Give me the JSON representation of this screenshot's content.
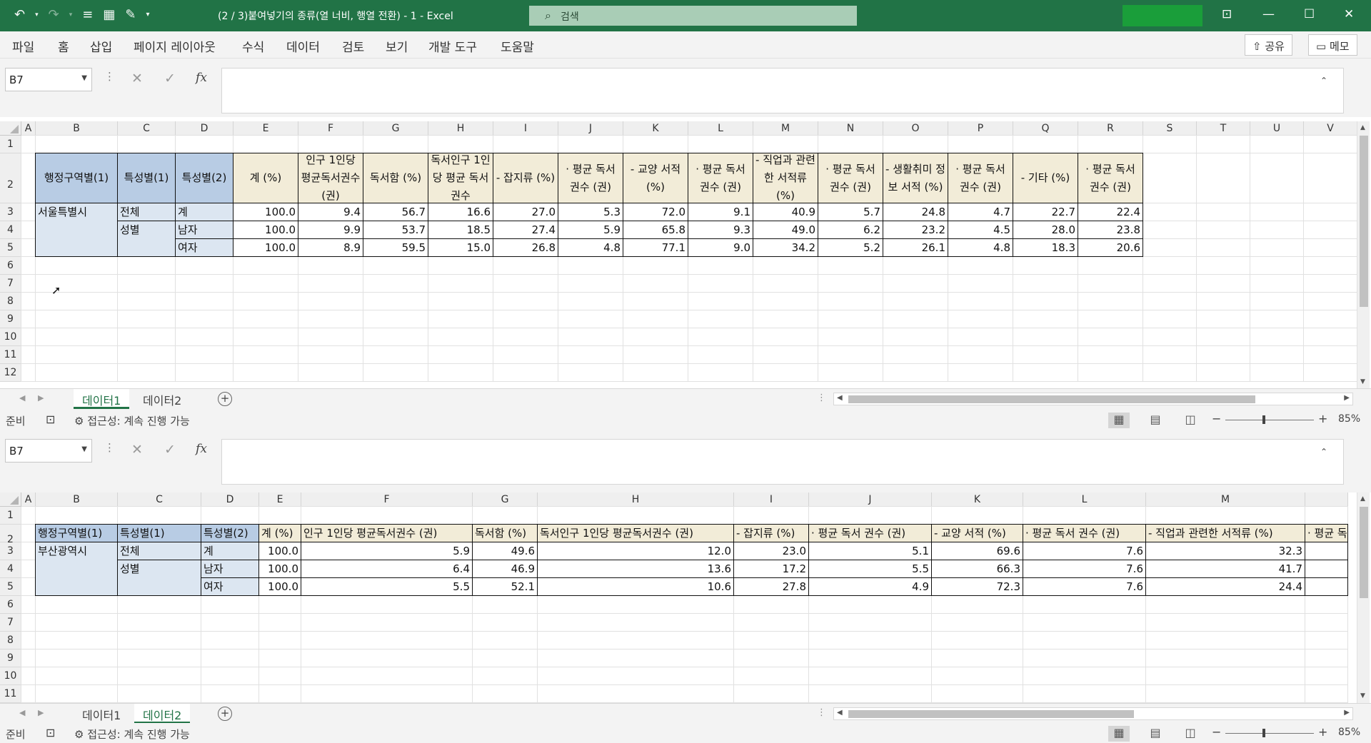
{
  "titlebar": {
    "undo_icon": "undo-icon",
    "title": "(2 / 3)붙여넣기의 종류(열 너비, 행열 전환)  -  1  -  Excel",
    "search_placeholder": "검색",
    "minimize": "—",
    "restore": "☐",
    "close": "✕",
    "ribbon_display": "⊡"
  },
  "menu": {
    "items": [
      "파일",
      "홈",
      "삽입",
      "페이지 레이아웃",
      "수식",
      "데이터",
      "검토",
      "보기",
      "개발 도구",
      "도움말"
    ],
    "share": "⇧ 공유",
    "memo": "▭ 메모"
  },
  "window1": {
    "namebox": "B7",
    "formula_value": "",
    "columns": [
      {
        "label": "A",
        "w": 20
      },
      {
        "label": "B",
        "w": 115
      },
      {
        "label": "C",
        "w": 81
      },
      {
        "label": "D",
        "w": 81
      },
      {
        "label": "E",
        "w": 91
      },
      {
        "label": "F",
        "w": 91
      },
      {
        "label": "G",
        "w": 91
      },
      {
        "label": "H",
        "w": 91
      },
      {
        "label": "I",
        "w": 91
      },
      {
        "label": "J",
        "w": 91
      },
      {
        "label": "K",
        "w": 91
      },
      {
        "label": "L",
        "w": 91
      },
      {
        "label": "M",
        "w": 91
      },
      {
        "label": "N",
        "w": 91
      },
      {
        "label": "O",
        "w": 91
      },
      {
        "label": "P",
        "w": 91
      },
      {
        "label": "Q",
        "w": 91
      },
      {
        "label": "R",
        "w": 91
      },
      {
        "label": "S",
        "w": 75
      },
      {
        "label": "T",
        "w": 75
      },
      {
        "label": "U",
        "w": 75
      },
      {
        "label": "V",
        "w": 75
      }
    ],
    "rows": [
      "1",
      "2",
      "3",
      "4",
      "5",
      "6",
      "7",
      "8",
      "9",
      "10",
      "11",
      "12"
    ],
    "headers": [
      "행정구역별(1)",
      "특성별(1)",
      "특성별(2)",
      "계 (%)",
      "인구 1인당 평균독서권수 (권)",
      "독서함 (%)",
      "독서인구 1인당 평균 독서권수",
      "- 잡지류 (%)",
      "· 평균 독서 권수 (권)",
      "- 교양 서적 (%)",
      "· 평균 독서 권수 (권)",
      "- 직업과 관련한 서적류 (%)",
      "· 평균 독서 권수 (권)",
      "- 생활취미 정보 서적 (%)",
      "· 평균 독서 권수 (권)",
      "- 기타 (%)",
      "· 평균 독서 권수 (권)"
    ],
    "region": "서울특별시",
    "cat1": [
      "전체",
      "성별"
    ],
    "cat2": [
      "계",
      "남자",
      "여자"
    ],
    "values": [
      [
        "100.0",
        "9.4",
        "56.7",
        "16.6",
        "27.0",
        "5.3",
        "72.0",
        "9.1",
        "40.9",
        "5.7",
        "24.8",
        "4.7",
        "22.7",
        "22.4"
      ],
      [
        "100.0",
        "9.9",
        "53.7",
        "18.5",
        "27.4",
        "5.9",
        "65.8",
        "9.3",
        "49.0",
        "6.2",
        "23.2",
        "4.5",
        "28.0",
        "23.8"
      ],
      [
        "100.0",
        "8.9",
        "59.5",
        "15.0",
        "26.8",
        "4.8",
        "77.1",
        "9.0",
        "34.2",
        "5.2",
        "26.1",
        "4.8",
        "18.3",
        "20.6"
      ]
    ],
    "tabs": [
      "데이터1",
      "데이터2"
    ],
    "active_tab": 0
  },
  "window2": {
    "namebox": "B7",
    "formula_value": "",
    "columns": [
      {
        "label": "A",
        "w": 20
      },
      {
        "label": "B",
        "w": 115
      },
      {
        "label": "C",
        "w": 117
      },
      {
        "label": "D",
        "w": 81
      },
      {
        "label": "E",
        "w": 59
      },
      {
        "label": "F",
        "w": 240
      },
      {
        "label": "G",
        "w": 91
      },
      {
        "label": "H",
        "w": 275
      },
      {
        "label": "I",
        "w": 105
      },
      {
        "label": "J",
        "w": 172
      },
      {
        "label": "K",
        "w": 128
      },
      {
        "label": "L",
        "w": 172
      },
      {
        "label": "M",
        "w": 223
      },
      {
        "label": "",
        "w": 60
      }
    ],
    "rows": [
      "1",
      "2",
      "3",
      "4",
      "5",
      "6",
      "7",
      "8",
      "9",
      "10",
      "11"
    ],
    "headers": [
      "행정구역별(1)",
      "특성별(1)",
      "특성별(2)",
      "계 (%)",
      "인구 1인당 평균독서권수 (권)",
      "독서함 (%)",
      "독서인구 1인당 평균독서권수 (권)",
      "- 잡지류 (%)",
      "· 평균 독서 권수 (권)",
      "- 교양 서적 (%)",
      "· 평균 독서 권수 (권)",
      "- 직업과 관련한 서적류 (%)",
      "· 평균 독"
    ],
    "region": "부산광역시",
    "cat1": [
      "전체",
      "성별"
    ],
    "cat2": [
      "계",
      "남자",
      "여자"
    ],
    "values": [
      [
        "100.0",
        "5.9",
        "49.6",
        "12.0",
        "23.0",
        "5.1",
        "69.6",
        "7.6",
        "32.3",
        ""
      ],
      [
        "100.0",
        "6.4",
        "46.9",
        "13.6",
        "17.2",
        "5.5",
        "66.3",
        "7.6",
        "41.7",
        ""
      ],
      [
        "100.0",
        "5.5",
        "52.1",
        "10.6",
        "27.8",
        "4.9",
        "72.3",
        "7.6",
        "24.4",
        ""
      ]
    ],
    "tabs": [
      "데이터1",
      "데이터2"
    ],
    "active_tab": 1
  },
  "status": {
    "ready": "준비",
    "accessibility": "접근성: 계속 진행 가능",
    "zoom": "85%"
  }
}
